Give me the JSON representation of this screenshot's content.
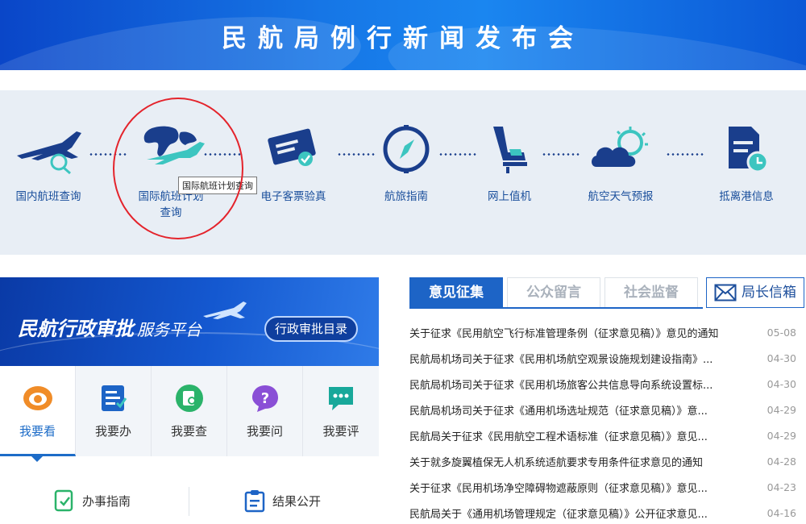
{
  "banner": {
    "title": "民航局例行新闻发布会"
  },
  "services": [
    {
      "label": "国内航班查询",
      "icon": "domestic-flight-icon"
    },
    {
      "label": "国际航班计划\n查询",
      "icon": "international-flight-icon"
    },
    {
      "label": "电子客票验真",
      "icon": "e-ticket-icon"
    },
    {
      "label": "航旅指南",
      "icon": "compass-icon"
    },
    {
      "label": "网上值机",
      "icon": "seat-icon"
    },
    {
      "label": "航空天气预报",
      "icon": "weather-icon"
    },
    {
      "label": "抵离港信息",
      "icon": "document-clock-icon"
    }
  ],
  "tooltip": "国际航班计划查询",
  "platform": {
    "title": "民航行政审批",
    "subtitle": "服务平台",
    "button": "行政审批目录"
  },
  "actions": [
    {
      "label": "我要看",
      "icon": "eye-icon"
    },
    {
      "label": "我要办",
      "icon": "form-icon"
    },
    {
      "label": "我要查",
      "icon": "search-doc-icon"
    },
    {
      "label": "我要问",
      "icon": "question-icon"
    },
    {
      "label": "我要评",
      "icon": "chat-icon"
    }
  ],
  "guides": [
    {
      "label": "办事指南",
      "icon": "guide-icon"
    },
    {
      "label": "结果公开",
      "icon": "clipboard-icon"
    }
  ],
  "tabs": [
    {
      "label": "意见征集"
    },
    {
      "label": "公众留言"
    },
    {
      "label": "社会监督"
    },
    {
      "label": "局长信箱"
    }
  ],
  "news": [
    {
      "title": "关于征求《民用航空飞行标准管理条例（征求意见稿）》意见的通知",
      "date": "05-08"
    },
    {
      "title": "民航局机场司关于征求《民用机场航空观景设施规划建设指南》...",
      "date": "04-30"
    },
    {
      "title": "民航局机场司关于征求《民用机场旅客公共信息导向系统设置标...",
      "date": "04-30"
    },
    {
      "title": "民航局机场司关于征求《通用机场选址规范（征求意见稿）》意...",
      "date": "04-29"
    },
    {
      "title": "民航局关于征求《民用航空工程术语标准（征求意见稿）》意见...",
      "date": "04-29"
    },
    {
      "title": "关于就多旋翼植保无人机系统适航要求专用条件征求意见的通知",
      "date": "04-28"
    },
    {
      "title": "关于征求《民用机场净空障碍物遮蔽原则（征求意见稿）》意见...",
      "date": "04-23"
    },
    {
      "title": "民航局关于《通用机场管理规定（征求意见稿）》公开征求意见...",
      "date": "04-16"
    }
  ],
  "colors": {
    "accent": "#1d64c6",
    "icon_navy": "#1a3e8c",
    "icon_teal": "#3cc5c0",
    "highlight_circle": "#e4232b"
  }
}
